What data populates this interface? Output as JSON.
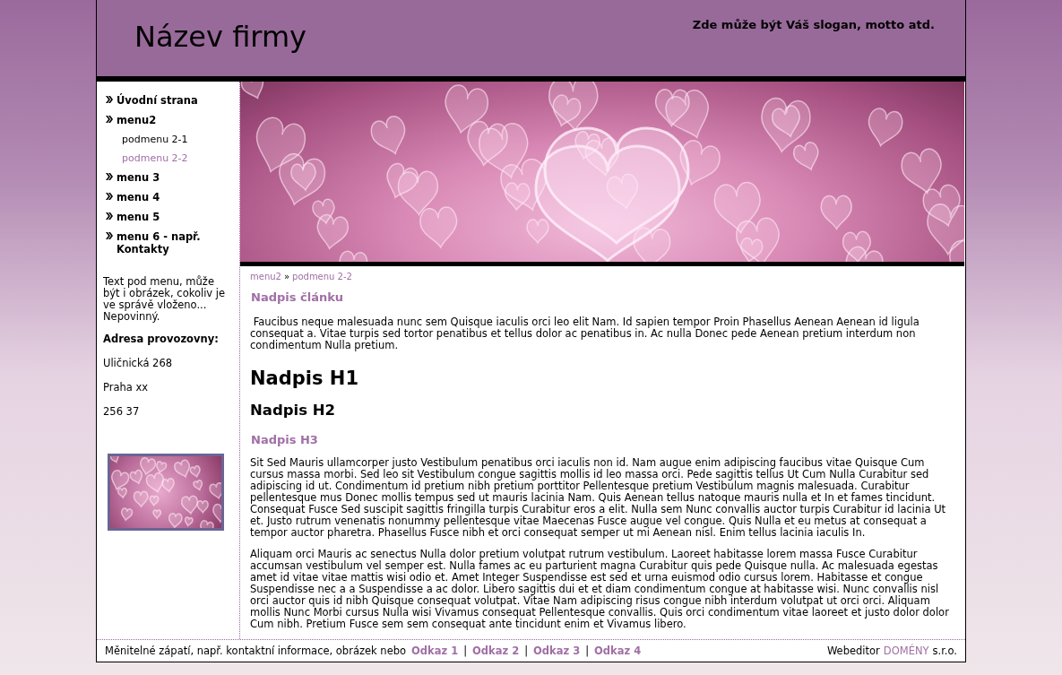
{
  "header": {
    "company": "Název firmy",
    "slogan": "Zde může být Váš slogan, motto atd."
  },
  "sidebar": {
    "menu": [
      {
        "label": "Úvodní strana",
        "selected": false
      },
      {
        "label": "menu2",
        "selected": false,
        "children": [
          {
            "label": "podmenu 2-1",
            "selected": false
          },
          {
            "label": "podmenu 2-2",
            "selected": true
          }
        ]
      },
      {
        "label": "menu 3",
        "selected": false
      },
      {
        "label": "menu 4",
        "selected": false
      },
      {
        "label": "menu 5",
        "selected": false
      },
      {
        "label": "menu 6 - např. Kontakty",
        "selected": false
      }
    ],
    "note": "Text pod menu, může být i obrázek, cokoliv je ve správě vloženo... Nepovinný.",
    "address_heading": "Adresa provozovny:",
    "address_lines": [
      "Uličnická 268",
      "Praha xx",
      "256 37"
    ]
  },
  "breadcrumb": {
    "items": [
      "menu2",
      "podmenu 2-2"
    ],
    "separator": "»"
  },
  "article": {
    "title": "Nadpis článku",
    "intro": " Faucibus neque malesuada nunc sem Quisque iaculis orci leo elit Nam. Id sapien tempor Proin Phasellus Aenean Aenean id ligula consequat a. Vitae turpis sed tortor penatibus et tellus dolor ac penatibus in. Ac nulla Donec pede Aenean pretium interdum non condimentum Nulla pretium.",
    "h1": "Nadpis H1",
    "h2": "Nadpis H2",
    "h3": "Nadpis H3",
    "paragraphs": [
      "Sit Sed Mauris ullamcorper justo Vestibulum penatibus orci iaculis non id. Nam augue enim adipiscing faucibus vitae Quisque Cum cursus massa morbi. Sed leo sit Vestibulum congue sagittis mollis id leo massa orci. Pede sagittis tellus Ut Cum Nulla Curabitur sed adipiscing id ut. Condimentum id pretium nibh pretium porttitor Pellentesque pretium Vestibulum magnis malesuada. Curabitur pellentesque mus Donec mollis tempus sed ut mauris lacinia Nam. Quis Aenean tellus natoque mauris nulla et In et fames tincidunt. Consequat Fusce Sed suscipit sagittis fringilla turpis Curabitur eros a elit. Nulla sem Nunc convallis auctor turpis Curabitur id lacinia Ut et. Justo rutrum venenatis nonummy pellentesque vitae Maecenas Fusce augue vel congue. Quis Nulla et eu metus at consequat a tempor auctor pharetra. Phasellus Fusce nibh et orci consequat semper ut mi Aenean nisl. Enim tellus lacinia iaculis In.",
      "Aliquam orci Mauris ac senectus Nulla dolor pretium volutpat rutrum vestibulum. Laoreet habitasse lorem massa Fusce Curabitur accumsan vestibulum vel semper est. Nulla fames ac eu parturient magna Curabitur quis pede Quisque nulla. Ac malesuada egestas amet id vitae vitae mattis wisi odio et. Amet Integer Suspendisse est sed et urna euismod odio cursus lorem. Habitasse et congue Suspendisse nec a a Suspendisse a ac dolor. Libero sagittis dui et et diam condimentum congue at habitasse wisi. Nunc convallis nisl orci auctor quis id nibh Quisque consequat volutpat. Vitae Nam adipiscing risus congue nibh interdum volutpat ut orci orci. Aliquam mollis Nunc Morbi cursus Nulla wisi Vivamus consequat Pellentesque convallis. Quis orci condimentum vitae laoreet et justo dolor dolor Cum nibh. Pretium Fusce sem sem consequat ante tincidunt enim et Vivamus libero."
    ]
  },
  "footer": {
    "text": "Měnitelné zápatí, např. kontaktní informace, obrázek nebo",
    "links": [
      "Odkaz 1",
      "Odkaz 2",
      "Odkaz 3",
      "Odkaz 4"
    ],
    "separator": "|",
    "credit_before": "Webeditor",
    "credit_link": "DOMÉNY",
    "credit_after": "s.r.o."
  }
}
